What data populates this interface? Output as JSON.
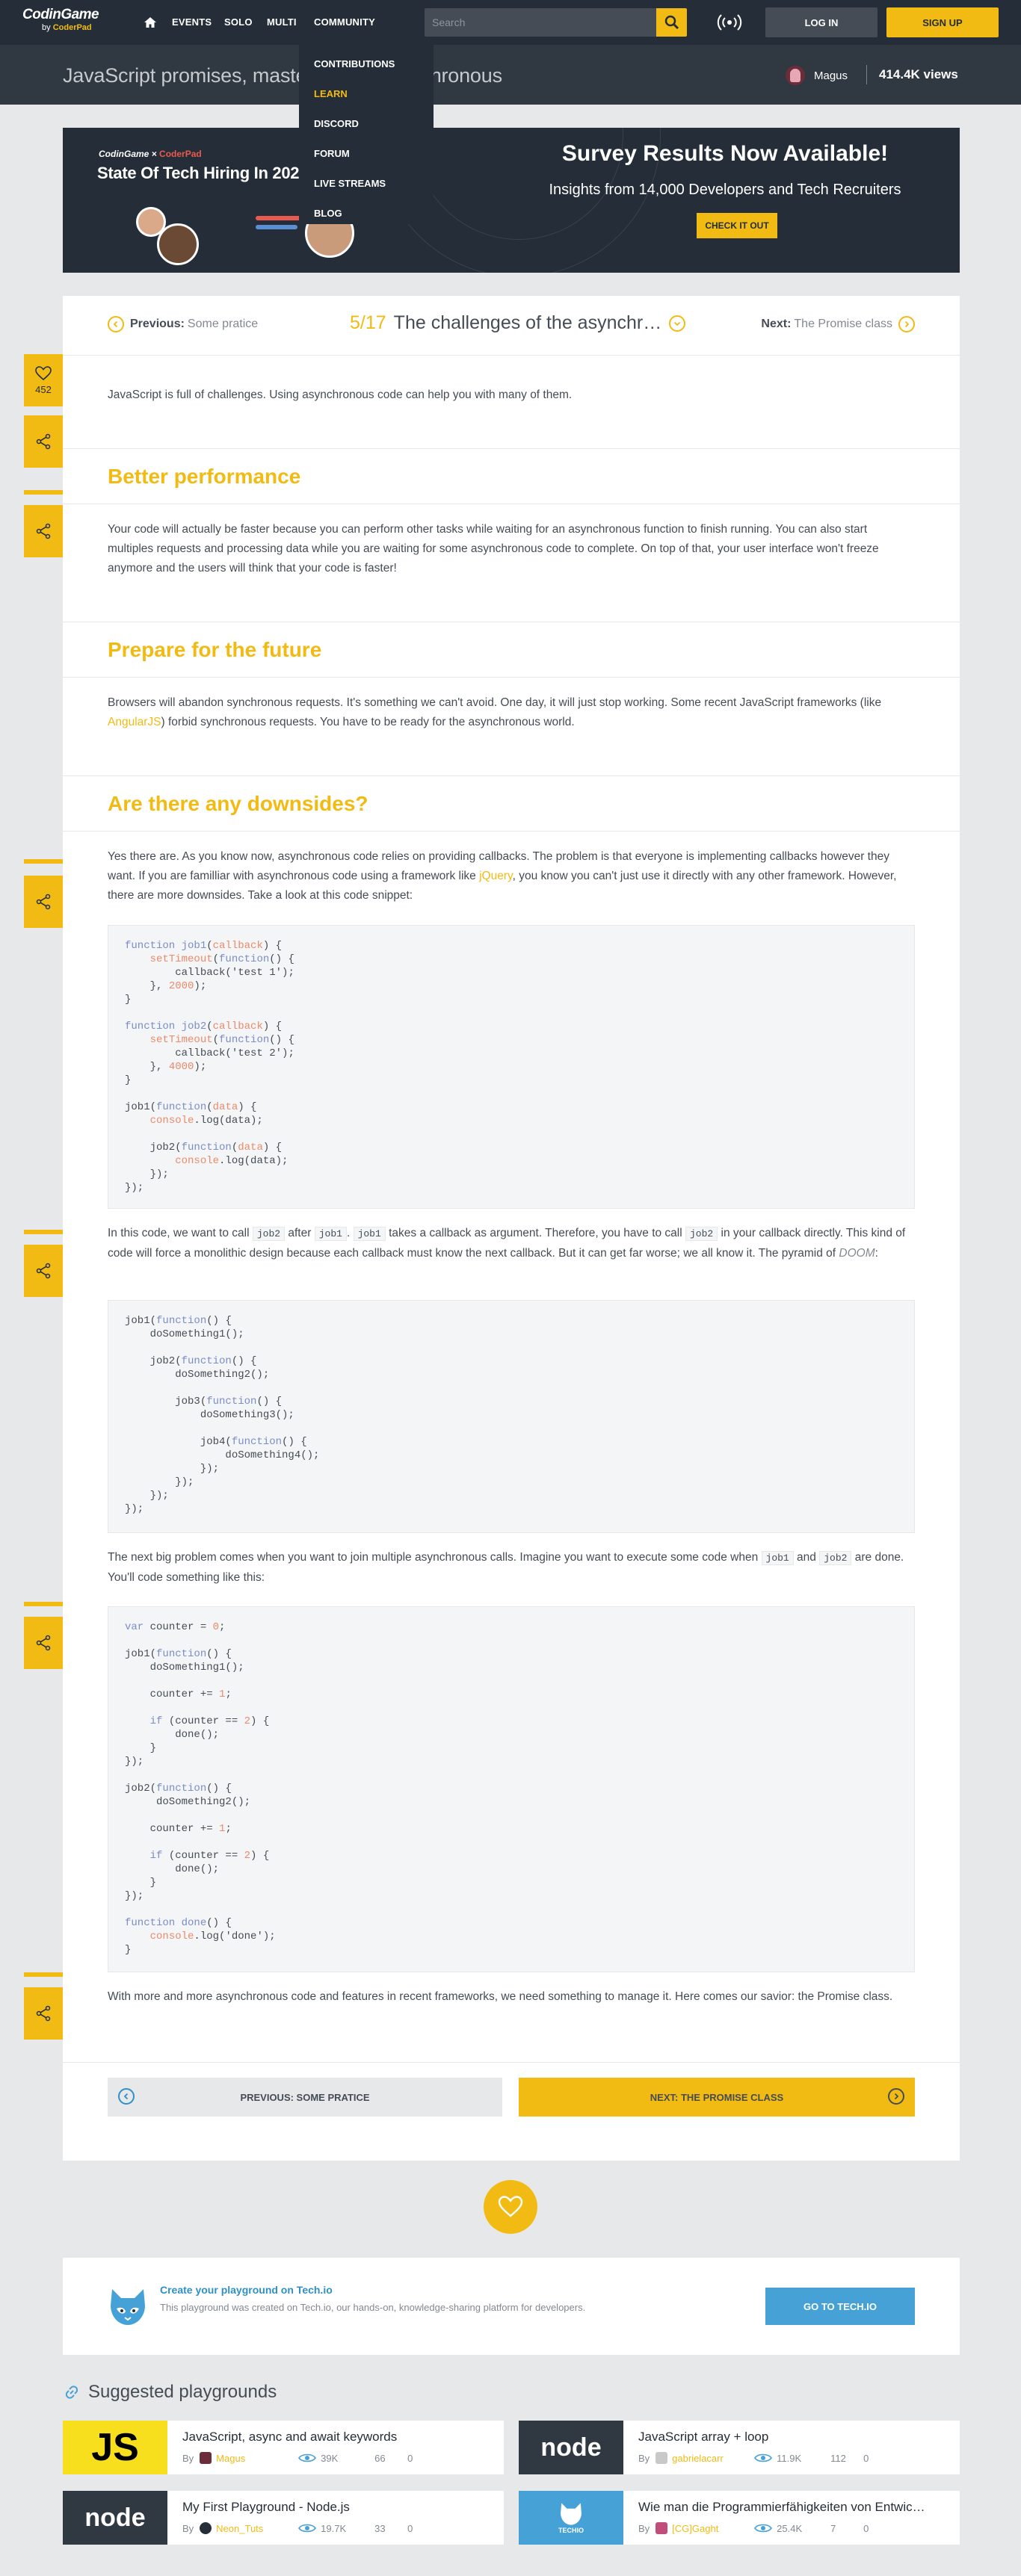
{
  "nav": {
    "logo_top": "CodinGame",
    "logo_by": "by",
    "logo_brand": "CoderPad",
    "links": [
      "EVENTS",
      "SOLO",
      "MULTI",
      "COMMUNITY"
    ],
    "search_placeholder": "Search",
    "login": "LOG IN",
    "signup": "SIGN UP"
  },
  "community_menu": [
    "CONTRIBUTIONS",
    "LEARN",
    "DISCORD",
    "FORUM",
    "LIVE STREAMS",
    "BLOG"
  ],
  "header": {
    "title": "JavaScript promises, mastering the asynchronous",
    "author": "Magus",
    "views": "414.4K views"
  },
  "banner": {
    "logo_cg": "CodinGame",
    "logo_cp": "CoderPad",
    "tag": "State Of Tech Hiring In 2023",
    "title": "Survey Results Now Available!",
    "subtitle": "Insights from 14,000 Developers and Tech Recruiters",
    "button": "CHECK IT OUT"
  },
  "chapter_nav": {
    "prev_label": "Previous:",
    "prev_title": "Some pratice",
    "index": "5/17",
    "current": "The challenges of the asynchr…",
    "next_label": "Next:",
    "next_title": "The Promise class"
  },
  "likes": "452",
  "content": {
    "intro": "JavaScript is full of challenges. Using asynchronous code can help you with many of them.",
    "h_perf": "Better performance",
    "p_perf": "Your code will actually be faster because you can perform other tasks while waiting for an asynchronous function to finish running. You can also start multiples requests and processing data while you are waiting for some asynchronous code to complete. On top of that, your user interface won't freeze anymore and the users will think that your code is faster!",
    "h_future": "Prepare for the future",
    "p_future_1": "Browsers will abandon synchronous requests. It's something we can't avoid. One day, it will just stop working. Some recent JavaScript frameworks (like ",
    "p_future_link": "AngularJS",
    "p_future_2": ") forbid synchronous requests. You have to be ready for the asynchronous world.",
    "h_down": "Are there any downsides?",
    "p_down_1": "Yes there are. As you know now, asynchronous code relies on providing callbacks. The problem is that everyone is implementing callbacks however they want. If you are familliar with asynchronous code using a framework like ",
    "p_down_link": "jQuery",
    "p_down_2": ", you know you can't just use it directly with any other framework. However, there are more downsides. Take a look at this code snippet:",
    "p_code1_a": "In this code, we want to call ",
    "p_code1_job2": "job2",
    "p_code1_b": " after ",
    "p_code1_job1": "job1",
    "p_code1_c": ". ",
    "p_code1_job1b": "job1",
    "p_code1_d": " takes a callback as argument. Therefore, you have to call ",
    "p_code1_job2b": "job2",
    "p_code1_e": " in your callback directly. This kind of code will force a monolithic design because each callback must know the next callback. But it can get far worse; we all know it. The pyramid of ",
    "p_code1_doom": "DOOM",
    "p_code1_f": ":",
    "p_join_a": "The next big problem comes when you want to join multiple asynchronous calls. Imagine you want to execute some code when ",
    "p_join_job1": "job1",
    "p_join_and": " and ",
    "p_join_job2": "job2",
    "p_join_b": " are done. You'll code something like this:",
    "p_end": "With more and more asynchronous code and features in recent frameworks, we need something to manage it. Here comes our savior: the Promise class."
  },
  "bottom_nav": {
    "prev": "PREVIOUS: SOME PRATICE",
    "next": "NEXT: THE PROMISE CLASS"
  },
  "techio": {
    "title": "Create your playground on Tech.io",
    "desc": "This playground was created on Tech.io, our hands-on, knowledge-sharing platform for developers.",
    "button": "GO TO TECH.IO"
  },
  "suggested": {
    "title": "Suggested playgrounds",
    "items": [
      {
        "title": "JavaScript, async and await keywords",
        "by": "By",
        "user": "Magus",
        "views": "39K",
        "c1": "66",
        "c2": "0",
        "thumb": "JS"
      },
      {
        "title": "JavaScript array + loop",
        "by": "By",
        "user": "gabrielacarr",
        "views": "11.9K",
        "c1": "112",
        "c2": "0",
        "thumb": "node"
      },
      {
        "title": "My First Playground - Node.js",
        "by": "By",
        "user": "Neon_Tuts",
        "views": "19.7K",
        "c1": "33",
        "c2": "0",
        "thumb": "node"
      },
      {
        "title": "Wie man die Programmierfähigkeiten von Entwic…",
        "by": "By",
        "user": "[CG]Gaght",
        "views": "25.4K",
        "c1": "7",
        "c2": "0",
        "thumb": "TECHIO"
      }
    ]
  },
  "colors": {
    "accent": "#f2bb13",
    "nav_bg": "#252e38",
    "link_blue": "#2f90c8"
  }
}
